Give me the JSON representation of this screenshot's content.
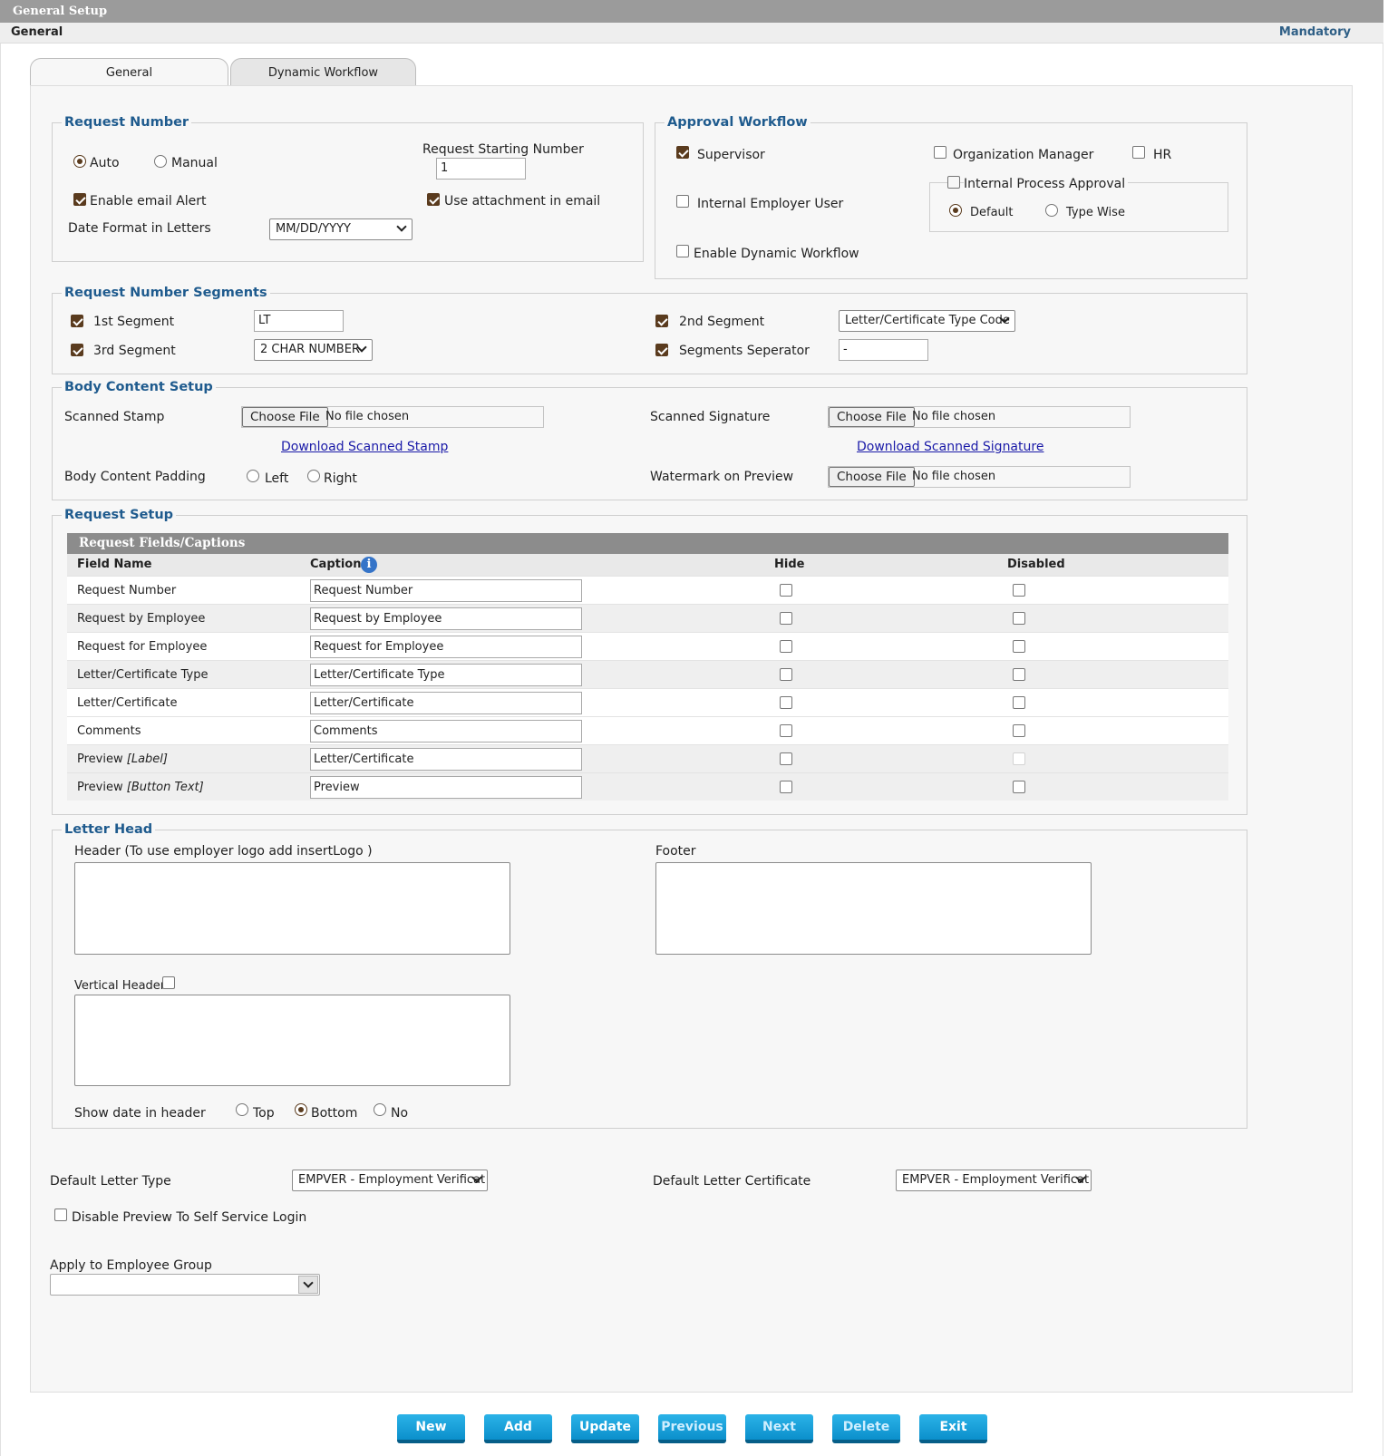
{
  "header": {
    "title": "General Setup",
    "section": "General",
    "mandatory": "Mandatory"
  },
  "tabs": [
    {
      "label": "General",
      "active": true
    },
    {
      "label": "Dynamic Workflow",
      "active": false
    }
  ],
  "request_number": {
    "legend": "Request Number",
    "auto_label": "Auto",
    "auto_selected": true,
    "manual_label": "Manual",
    "starting_number_label": "Request Starting Number",
    "starting_number_value": "1",
    "email_alert_label": "Enable email Alert",
    "email_alert_checked": true,
    "attachment_label": "Use attachment in email",
    "attachment_checked": true,
    "date_format_label": "Date Format in Letters",
    "date_format_value": "MM/DD/YYYY"
  },
  "approval_workflow": {
    "legend": "Approval Workflow",
    "supervisor_label": "Supervisor",
    "supervisor_checked": true,
    "org_manager_label": "Organization Manager",
    "hr_label": "HR",
    "internal_process_label": "Internal Process Approval",
    "default_label": "Default",
    "default_selected": true,
    "type_wise_label": "Type Wise",
    "internal_employer_label": "Internal Employer User",
    "dynamic_workflow_label": "Enable Dynamic Workflow"
  },
  "segments": {
    "legend": "Request Number Segments",
    "first_label": "1st Segment",
    "first_value": "LT",
    "second_label": "2nd Segment",
    "second_value": "Letter/Certificate Type Code",
    "third_label": "3rd Segment",
    "third_value": "2 CHAR NUMBER",
    "separator_label": "Segments Seperator",
    "separator_value": "-"
  },
  "body_content": {
    "legend": "Body Content Setup",
    "stamp_label": "Scanned Stamp",
    "signature_label": "Scanned Signature",
    "choose_file": "Choose File",
    "no_file": "No file chosen",
    "download_stamp": "Download Scanned Stamp",
    "download_signature": "Download Scanned Signature",
    "padding_label": "Body Content Padding",
    "left_label": "Left",
    "right_label": "Right",
    "watermark_label": "Watermark on Preview"
  },
  "request_setup": {
    "legend": "Request Setup",
    "grid_title": "Request Fields/Captions",
    "columns": {
      "field": "Field Name",
      "caption": "Caption",
      "hide": "Hide",
      "disabled": "Disabled"
    },
    "info_icon": "i",
    "rows": [
      {
        "field": "Request Number",
        "field_em": "",
        "caption": "Request Number"
      },
      {
        "field": "Request by Employee",
        "field_em": "",
        "caption": "Request by Employee"
      },
      {
        "field": "Request for Employee",
        "field_em": "",
        "caption": "Request for Employee"
      },
      {
        "field": "Letter/Certificate Type",
        "field_em": "",
        "caption": "Letter/Certificate Type"
      },
      {
        "field": "Letter/Certificate",
        "field_em": "",
        "caption": "Letter/Certificate"
      },
      {
        "field": "Comments",
        "field_em": "",
        "caption": "Comments"
      },
      {
        "field": "Preview ",
        "field_em": "[Label]",
        "caption": "Letter/Certificate"
      },
      {
        "field": "Preview ",
        "field_em": "[Button Text]",
        "caption": "Preview"
      }
    ]
  },
  "letter_head": {
    "legend": "Letter Head",
    "header_label": "Header (To use employer logo add insertLogo )",
    "footer_label": "Footer",
    "vertical_header_label": "Vertical Header",
    "show_date_label": "Show date in header",
    "top_label": "Top",
    "bottom_label": "Bottom",
    "bottom_selected": true,
    "no_label": "No"
  },
  "defaults": {
    "letter_type_label": "Default Letter Type",
    "letter_type_value": "EMPVER - Employment Verificat",
    "letter_certificate_label": "Default Letter Certificate",
    "letter_certificate_value": "EMPVER - Employment Verificat",
    "disable_preview_label": "Disable Preview To Self Service Login",
    "employee_group_label": "Apply to Employee Group",
    "employee_group_value": ""
  },
  "buttons": [
    {
      "label": "New"
    },
    {
      "label": "Add"
    },
    {
      "label": "Update"
    },
    {
      "label": "Previous"
    },
    {
      "label": "Next"
    },
    {
      "label": "Delete"
    },
    {
      "label": "Exit"
    }
  ],
  "colors": {
    "accent": "#1f5b8e",
    "button": "#0b8fcb",
    "checkbox": "#5a3b1e"
  }
}
